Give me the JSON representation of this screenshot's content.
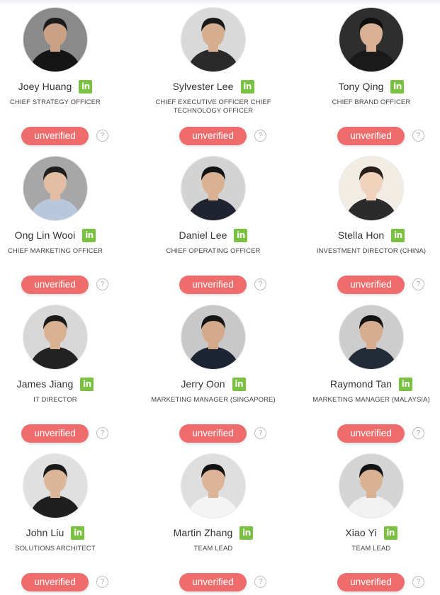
{
  "team": [
    {
      "name": "Joey Huang",
      "title": "CHIEF STRATEGY OFFICER",
      "status": "unverified",
      "help": "?",
      "social": "in",
      "photo": {
        "bg": "#8a8a8a",
        "skin": "#c9a184",
        "hair": "#1c1c1c",
        "shirt": "#151515"
      }
    },
    {
      "name": "Sylvester Lee",
      "title": "CHIEF EXECUTIVE OFFICER CHIEF TECHNOLOGY OFFICER",
      "status": "unverified",
      "help": "?",
      "social": "in",
      "photo": {
        "bg": "#d9d9d9",
        "skin": "#d6ae90",
        "hair": "#1a1a1a",
        "shirt": "#2a2a2a"
      }
    },
    {
      "name": "Tony Qing",
      "title": "CHIEF BRAND OFFICER",
      "status": "unverified",
      "help": "?",
      "social": "in",
      "photo": {
        "bg": "#2e2e2e",
        "skin": "#d8b095",
        "hair": "#0f0f0f",
        "shirt": "#1a1a1a"
      }
    },
    {
      "name": "Ong Lin Wooi",
      "title": "CHIEF MARKETING OFFICER",
      "status": "unverified",
      "help": "?",
      "social": "in",
      "photo": {
        "bg": "#a7a7a7",
        "skin": "#e2bfa4",
        "hair": "#1e1e1e",
        "shirt": "#b9c7dc"
      }
    },
    {
      "name": "Daniel Lee",
      "title": "CHIEF OPERATING OFFICER",
      "status": "unverified",
      "help": "?",
      "social": "in",
      "photo": {
        "bg": "#d3d3d3",
        "skin": "#d9b294",
        "hair": "#141414",
        "shirt": "#1f2430"
      }
    },
    {
      "name": "Stella Hon",
      "title": "INVESTMENT DIRECTOR (CHINA)",
      "status": "unverified",
      "help": "?",
      "social": "in",
      "photo": {
        "bg": "#f1ece4",
        "skin": "#f0d3bd",
        "hair": "#2a1f1a",
        "shirt": "#2b2b2b"
      }
    },
    {
      "name": "James Jiang",
      "title": "IT DIRECTOR",
      "status": "unverified",
      "help": "?",
      "social": "in",
      "photo": {
        "bg": "#d7d7d7",
        "skin": "#d8b191",
        "hair": "#1b1b1b",
        "shirt": "#222222"
      }
    },
    {
      "name": "Jerry Oon",
      "title": "MARKETING MANAGER (SINGAPORE)",
      "status": "unverified",
      "help": "?",
      "social": "in",
      "photo": {
        "bg": "#c8c8c8",
        "skin": "#d3a98a",
        "hair": "#161616",
        "shirt": "#1d2433"
      }
    },
    {
      "name": "Raymond Tan",
      "title": "MARKETING MANAGER (MALAYSIA)",
      "status": "unverified",
      "help": "?",
      "social": "in",
      "photo": {
        "bg": "#cdcdcd",
        "skin": "#d6ad8f",
        "hair": "#141414",
        "shirt": "#232a38"
      }
    },
    {
      "name": "John Liu",
      "title": "SOLUTIONS ARCHITECT",
      "status": "unverified",
      "help": "?",
      "social": "in",
      "photo": {
        "bg": "#e0e0e0",
        "skin": "#dcb69a",
        "hair": "#1a1a1a",
        "shirt": "#1f1f1f"
      }
    },
    {
      "name": "Martin Zhang",
      "title": "TEAM LEAD",
      "status": "unverified",
      "help": "?",
      "social": "in",
      "photo": {
        "bg": "#dedede",
        "skin": "#dcb497",
        "hair": "#121212",
        "shirt": "#f4f4f4"
      }
    },
    {
      "name": "Xiao Yi",
      "title": "TEAM LEAD",
      "status": "unverified",
      "help": "?",
      "social": "in",
      "photo": {
        "bg": "#d4d4d4",
        "skin": "#d9b193",
        "hair": "#141414",
        "shirt": "#f1f1f1"
      }
    }
  ],
  "colors": {
    "unverified": "#ef6c6c",
    "linkedin": "#7ac142",
    "name": "#333333",
    "title": "#444444"
  },
  "icons": {
    "social": "linkedin-icon",
    "help": "question-circle-icon"
  }
}
